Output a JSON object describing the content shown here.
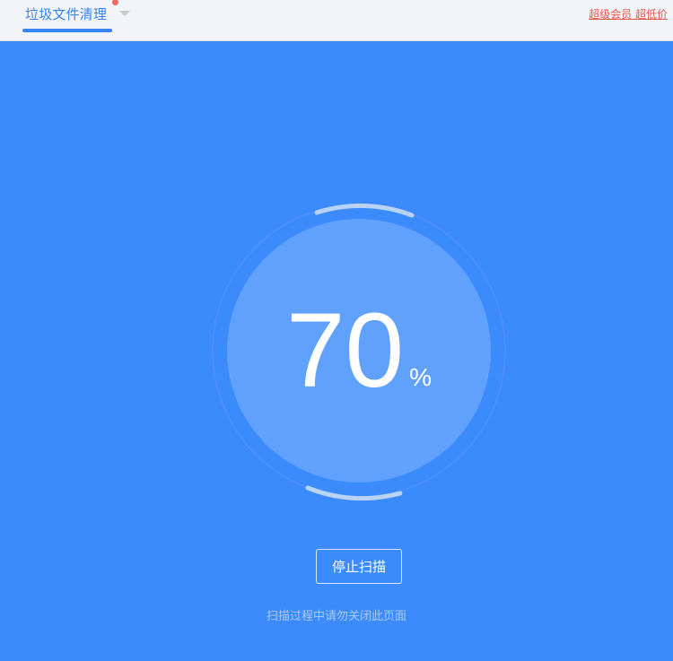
{
  "header": {
    "tab_label": "垃圾文件清理",
    "promo_label": "超级会员 超低价"
  },
  "scan": {
    "progress_value": "70",
    "progress_unit": "%",
    "progress_fraction": 0.7,
    "stop_button_label": "停止扫描",
    "hint_text": "扫描过程中请勿关闭此页面"
  },
  "colors": {
    "background": "#3b8bfd",
    "accent": "#3a84f0",
    "inner_circle": "#60a1fe",
    "promo": "#e8574e"
  },
  "icons": {
    "tab_dropdown": "chevron-down-icon",
    "tab_notification": "red-dot-badge"
  }
}
